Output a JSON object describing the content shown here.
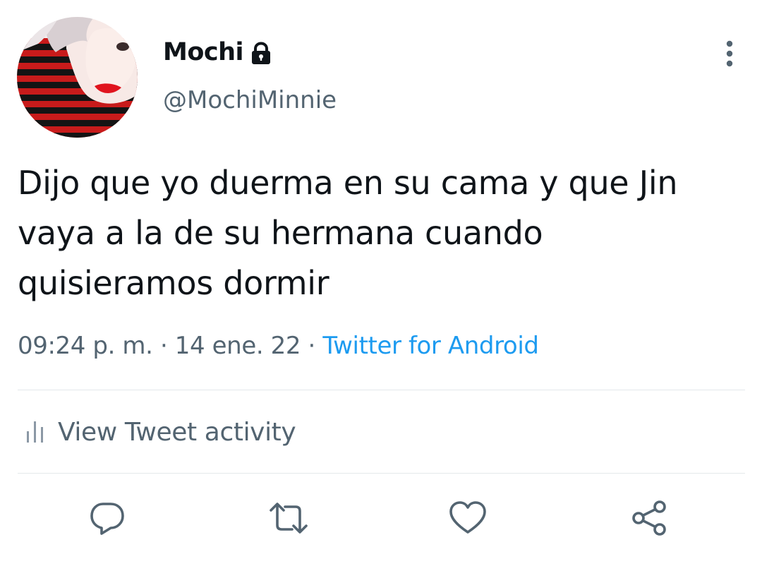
{
  "user": {
    "display_name": "Mochi",
    "handle": "@MochiMinnie",
    "protected_icon": "lock-icon",
    "avatar_icon": "profile-photo"
  },
  "tweet": {
    "text": "Dijo que yo duerma en su cama y que Jin vaya a la de su hermana cuando quisieramos dormir",
    "time": "09:24 p. m.",
    "separator": "·",
    "date": "14 ene. 22",
    "source": "Twitter for Android"
  },
  "activity": {
    "label": "View Tweet activity",
    "icon": "bar-chart-icon"
  },
  "actions": [
    {
      "name": "reply",
      "icon": "reply-icon"
    },
    {
      "name": "retweet",
      "icon": "retweet-icon"
    },
    {
      "name": "like",
      "icon": "heart-icon"
    },
    {
      "name": "share",
      "icon": "share-icon"
    }
  ],
  "colors": {
    "text_primary": "#0f1419",
    "text_secondary": "#536471",
    "link": "#1d9bf0",
    "divider": "#e4e8eb"
  }
}
